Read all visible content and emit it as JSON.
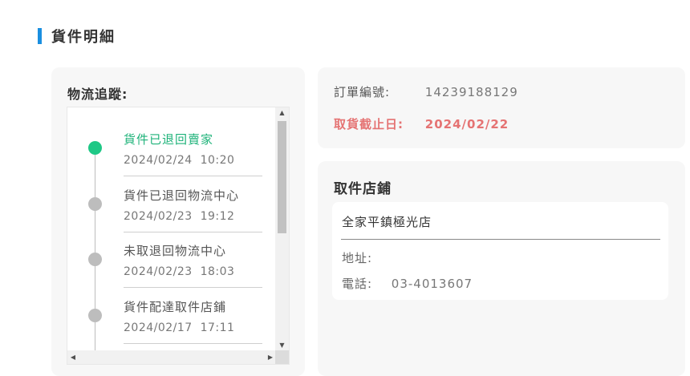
{
  "section_title": "貨件明細",
  "tracking": {
    "title": "物流追蹤:",
    "items": [
      {
        "status": "貨件已退回賣家",
        "time": "2024/02/24  10:20",
        "active": true
      },
      {
        "status": "貨件已退回物流中心",
        "time": "2024/02/23  19:12",
        "active": false
      },
      {
        "status": "未取退回物流中心",
        "time": "2024/02/23  18:03",
        "active": false
      },
      {
        "status": "貨件配達取件店鋪",
        "time": "2024/02/17  17:11",
        "active": false
      }
    ]
  },
  "order": {
    "number_label": "訂單編號:",
    "number_value": "14239188129",
    "deadline_label": "取貨截止日:",
    "deadline_value": "2024/02/22"
  },
  "store": {
    "title": "取件店鋪",
    "name": "全家平鎮極光店",
    "address_label": "地址:",
    "address_value": "",
    "phone_label": "電話:",
    "phone_value": "03-4013607"
  },
  "colors": {
    "accent": "#1a8fe0",
    "active_green": "#1fc886",
    "deadline_red": "#e57373",
    "dot_gray": "#bdbdbd"
  },
  "icons": {
    "scroll_up": "▲",
    "scroll_down": "▼",
    "scroll_left": "◀",
    "scroll_right": "▶"
  }
}
